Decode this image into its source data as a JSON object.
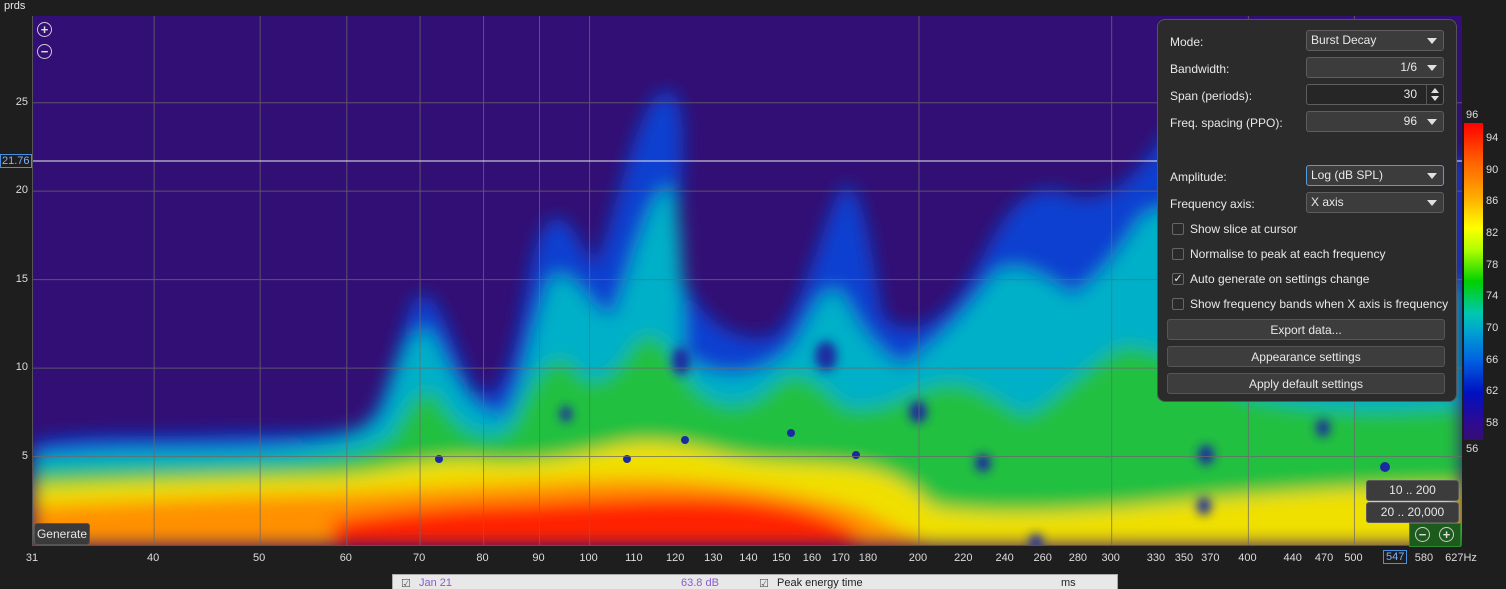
{
  "y_axis": {
    "unit": "prds",
    "ticks": [
      {
        "label": "25",
        "v": 25
      },
      {
        "label": "20",
        "v": 20
      },
      {
        "label": "15",
        "v": 15
      },
      {
        "label": "10",
        "v": 10
      },
      {
        "label": "5",
        "v": 5
      }
    ],
    "cursor_value": "21.76"
  },
  "x_axis": {
    "ticks": [
      "31",
      "40",
      "50",
      "60",
      "70",
      "80",
      "90",
      "100",
      "110",
      "120",
      "130",
      "140",
      "150",
      "160",
      "170",
      "180",
      "200",
      "220",
      "240",
      "260",
      "280",
      "300",
      "330",
      "350",
      "370",
      "400",
      "440",
      "470",
      "500",
      "547",
      "580",
      "627Hz"
    ],
    "tick_values": [
      31,
      40,
      50,
      60,
      70,
      80,
      90,
      100,
      110,
      120,
      130,
      140,
      150,
      160,
      170,
      180,
      200,
      220,
      240,
      260,
      280,
      300,
      330,
      350,
      370,
      400,
      440,
      470,
      500,
      547,
      580,
      627
    ],
    "cursor_value": "547"
  },
  "buttons": {
    "generate": "Generate",
    "range_1": "10 .. 200",
    "range_2": "20 .. 20,000"
  },
  "panel": {
    "mode_label": "Mode:",
    "mode_value": "Burst Decay",
    "bandwidth_label": "Bandwidth:",
    "bandwidth_value": "1/6",
    "span_label": "Span (periods):",
    "span_value": "30",
    "ppo_label": "Freq. spacing (PPO):",
    "ppo_value": "96",
    "amplitude_label": "Amplitude:",
    "amplitude_value": "Log (dB SPL)",
    "freq_axis_label": "Frequency axis:",
    "freq_axis_value": "X axis",
    "checkboxes": [
      {
        "label": "Show slice at cursor",
        "checked": false
      },
      {
        "label": "Normalise to peak at each frequency",
        "checked": false
      },
      {
        "label": "Auto generate on settings change",
        "checked": true
      },
      {
        "label": "Show frequency bands when X axis is frequency",
        "checked": false
      }
    ],
    "export_button": "Export data...",
    "appearance_button": "Appearance settings",
    "defaults_button": "Apply default settings"
  },
  "colorbar": {
    "top_label": "96",
    "bottom_label": "56",
    "ticks": [
      "94",
      "90",
      "86",
      "82",
      "78",
      "74",
      "70",
      "66",
      "62",
      "58"
    ]
  },
  "bottom_strip": {
    "item1": "Jan 21",
    "item2": "63.8 dB",
    "item3": "Peak energy time",
    "item4": "ms"
  },
  "colors": {
    "background": "#320f74",
    "accent": "#4a90e2"
  }
}
